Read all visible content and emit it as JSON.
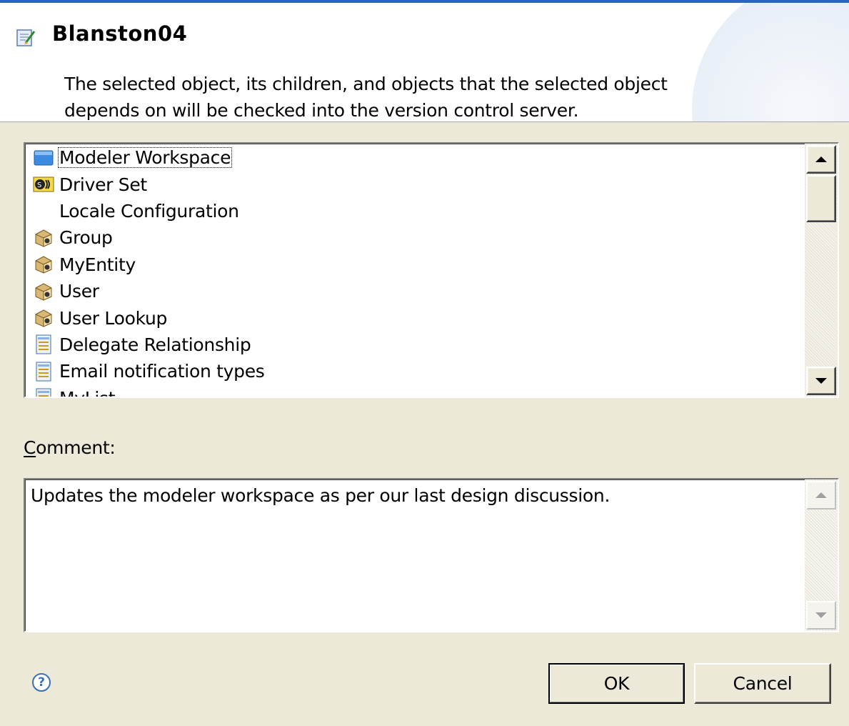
{
  "dialog": {
    "title": "Blanston04",
    "description_line1": "The selected object, its children, and objects that the selected object",
    "description_line2": "depends on will be checked into the version control server."
  },
  "objects": [
    {
      "label": "Modeler Workspace",
      "icon": "workspace-icon",
      "focused": true
    },
    {
      "label": "Driver Set",
      "icon": "driver-set-icon"
    },
    {
      "label": "Locale Configuration",
      "icon": ""
    },
    {
      "label": "Group",
      "icon": "entity-icon"
    },
    {
      "label": "MyEntity",
      "icon": "entity-icon"
    },
    {
      "label": "User",
      "icon": "entity-icon"
    },
    {
      "label": "User Lookup",
      "icon": "entity-icon"
    },
    {
      "label": "Delegate Relationship",
      "icon": "list-icon"
    },
    {
      "label": "Email notification types",
      "icon": "list-icon"
    },
    {
      "label": "MyList",
      "icon": "list-icon"
    }
  ],
  "comment": {
    "label": "Comment:",
    "mnemonic": "C",
    "label_rest": "omment:",
    "value": "Updates the modeler workspace as per our last design discussion."
  },
  "buttons": {
    "help": "?",
    "ok": "OK",
    "cancel": "Cancel"
  },
  "colors": {
    "dialog_bg": "#ece9d8",
    "title_bar_accent": "#2a64c4",
    "help_icon": "#3b6fb6"
  }
}
